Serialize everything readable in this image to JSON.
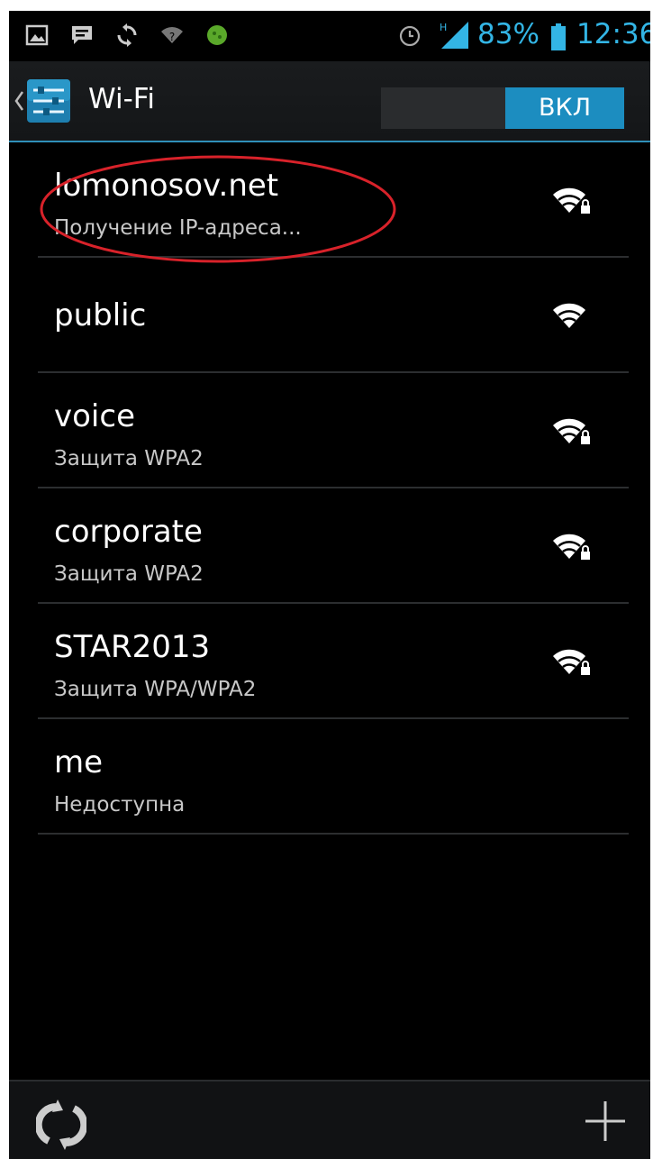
{
  "status_bar": {
    "battery_percent": "83%",
    "time": "12:36",
    "icons": [
      "image-icon",
      "message-icon",
      "sync-icon",
      "wifi-question-icon",
      "android-icon",
      "alarm-icon",
      "signal-h-icon",
      "battery-icon"
    ]
  },
  "action_bar": {
    "title": "Wi-Fi",
    "toggle_label": "ВКЛ",
    "toggle_state": "on",
    "accent_color": "#1c8dc0"
  },
  "networks": [
    {
      "name": "lomonosov.net",
      "status": "Получение IP-адреса...",
      "secured": true,
      "highlighted": true
    },
    {
      "name": "public",
      "status": "",
      "secured": false
    },
    {
      "name": "voice",
      "status": "Защита WPA2",
      "secured": true
    },
    {
      "name": "corporate",
      "status": "Защита WPA2",
      "secured": true
    },
    {
      "name": "STAR2013",
      "status": "Защита WPA/WPA2",
      "secured": true
    },
    {
      "name": "me",
      "status": "Недоступна",
      "secured": false,
      "unavailable": true
    }
  ],
  "bottom_bar": {
    "actions": [
      "scan-icon",
      "add-network-icon"
    ]
  },
  "highlight_color": "#d8222a"
}
